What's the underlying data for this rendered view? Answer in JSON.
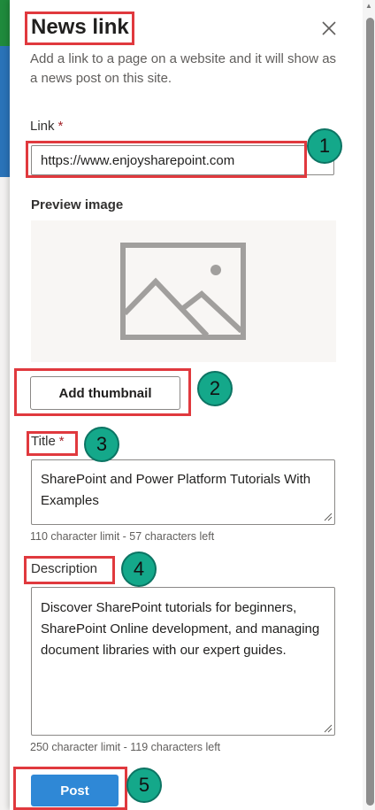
{
  "panel": {
    "title": "News link",
    "subtitle": "Add a link to a page on a website and it will show as a news post on this site."
  },
  "link": {
    "label": "Link",
    "required_mark": "*",
    "value": "https://www.enjoysharepoint.com"
  },
  "preview": {
    "label": "Preview image",
    "icon": "image-placeholder-icon",
    "add_thumbnail_label": "Add thumbnail"
  },
  "title_field": {
    "label": "Title",
    "required_mark": "*",
    "value": "SharePoint and Power Platform Tutorials With Examples",
    "hint": "110 character limit - 57 characters left"
  },
  "description_field": {
    "label": "Description",
    "value": "Discover SharePoint tutorials for beginners, SharePoint Online development, and managing document libraries with our expert guides.",
    "hint": "250 character limit - 119 characters left"
  },
  "post_label": "Post",
  "annotations": [
    "1",
    "2",
    "3",
    "4",
    "5"
  ],
  "colors": {
    "accent": "#2f88d6",
    "annotation_red": "#e0393e",
    "badge_green": "#14a88a",
    "required": "#a4262c"
  }
}
